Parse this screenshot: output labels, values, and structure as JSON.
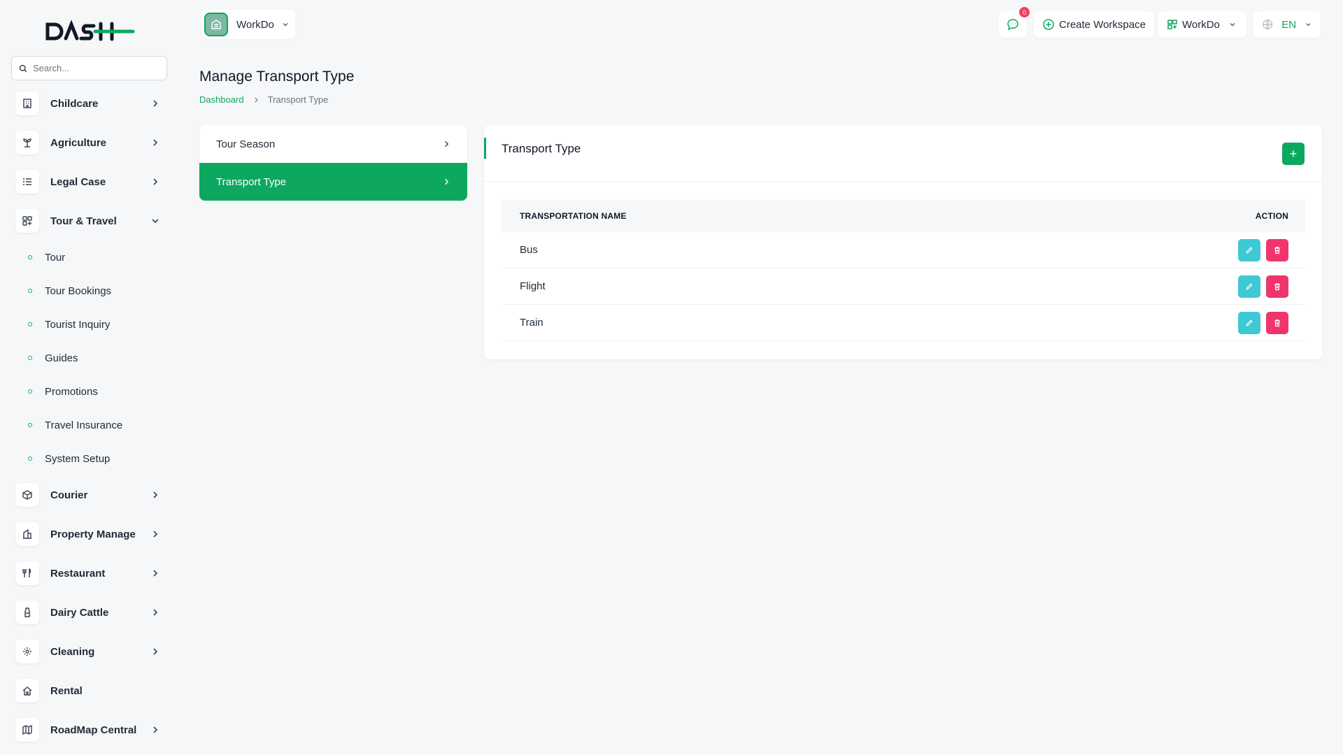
{
  "brand": {
    "logo_text": "DASH"
  },
  "search": {
    "placeholder": "Search..."
  },
  "sidebar": {
    "items": [
      {
        "label": "Childcare"
      },
      {
        "label": "Agriculture"
      },
      {
        "label": "Legal Case"
      },
      {
        "label": "Tour & Travel"
      },
      {
        "label": "Courier"
      },
      {
        "label": "Property Manage"
      },
      {
        "label": "Restaurant"
      },
      {
        "label": "Dairy Cattle"
      },
      {
        "label": "Cleaning"
      },
      {
        "label": "Rental"
      },
      {
        "label": "RoadMap Central"
      }
    ],
    "sub_items": [
      {
        "label": "Tour"
      },
      {
        "label": "Tour Bookings"
      },
      {
        "label": "Tourist Inquiry"
      },
      {
        "label": "Guides"
      },
      {
        "label": "Promotions"
      },
      {
        "label": "Travel Insurance"
      },
      {
        "label": "System Setup"
      }
    ]
  },
  "header": {
    "workspace_name": "WorkDo",
    "notifications_count": "0",
    "create_workspace_label": "Create Workspace",
    "workspace_switch_label": "WorkDo",
    "language_label": "EN"
  },
  "page": {
    "title": "Manage Transport Type",
    "breadcrumb": {
      "home": "Dashboard",
      "current": "Transport Type"
    }
  },
  "settings_menu": [
    {
      "label": "Tour Season"
    },
    {
      "label": "Transport Type"
    }
  ],
  "card": {
    "title": "Transport Type",
    "add_label": "+",
    "columns": {
      "name": "TRANSPORTATION NAME",
      "action": "ACTION"
    },
    "rows": [
      {
        "name": "Bus"
      },
      {
        "name": "Flight"
      },
      {
        "name": "Train"
      }
    ]
  },
  "colors": {
    "accent": "#0ea760",
    "edit": "#3ec9d6",
    "delete": "#f0356d"
  }
}
